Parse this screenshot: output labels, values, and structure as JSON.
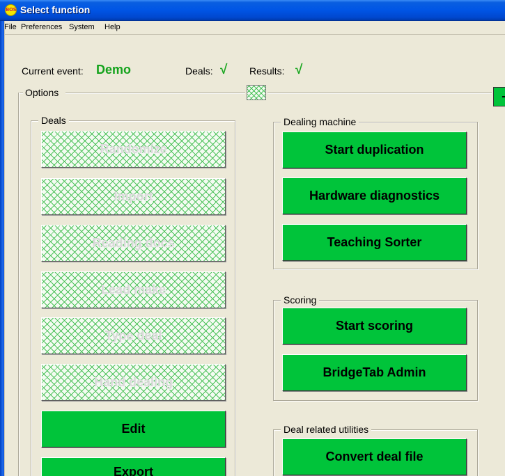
{
  "window": {
    "title": "Select function",
    "icon_text": "BOS"
  },
  "menu": [
    "File",
    "Preferences",
    "System",
    "Help"
  ],
  "event": {
    "current_label": "Current event:",
    "current_value": "Demo",
    "deals_label": "Deals:",
    "deals_status": "√",
    "results_label": "Results:",
    "results_status": "√"
  },
  "options": {
    "label": "Options",
    "edge_button_glyph": "−"
  },
  "deals_group": {
    "title": "Deals",
    "buttons": [
      {
        "label": "Randomize",
        "enabled": false
      },
      {
        "label": "Import",
        "enabled": false
      },
      {
        "label": "Reading docs",
        "enabled": false
      },
      {
        "label": "Lead make",
        "enabled": false
      },
      {
        "label": "Type deal",
        "enabled": false
      },
      {
        "label": "Hand dealing",
        "enabled": false
      },
      {
        "label": "Edit",
        "enabled": true
      },
      {
        "label": "Export",
        "enabled": true
      }
    ]
  },
  "dealing_machine_group": {
    "title": "Dealing machine",
    "buttons": [
      "Start duplication",
      "Hardware diagnostics",
      "Teaching Sorter"
    ]
  },
  "scoring_group": {
    "title": "Scoring",
    "buttons": [
      "Start scoring",
      "BridgeTab Admin"
    ]
  },
  "utilities_group": {
    "title": "Deal related utilities",
    "buttons": [
      "Convert deal file"
    ]
  },
  "colors": {
    "button_green": "#00c43a",
    "status_green": "#14a31c",
    "titlebar_blue": "#0055e5",
    "panel_bg": "#ece9d8"
  }
}
